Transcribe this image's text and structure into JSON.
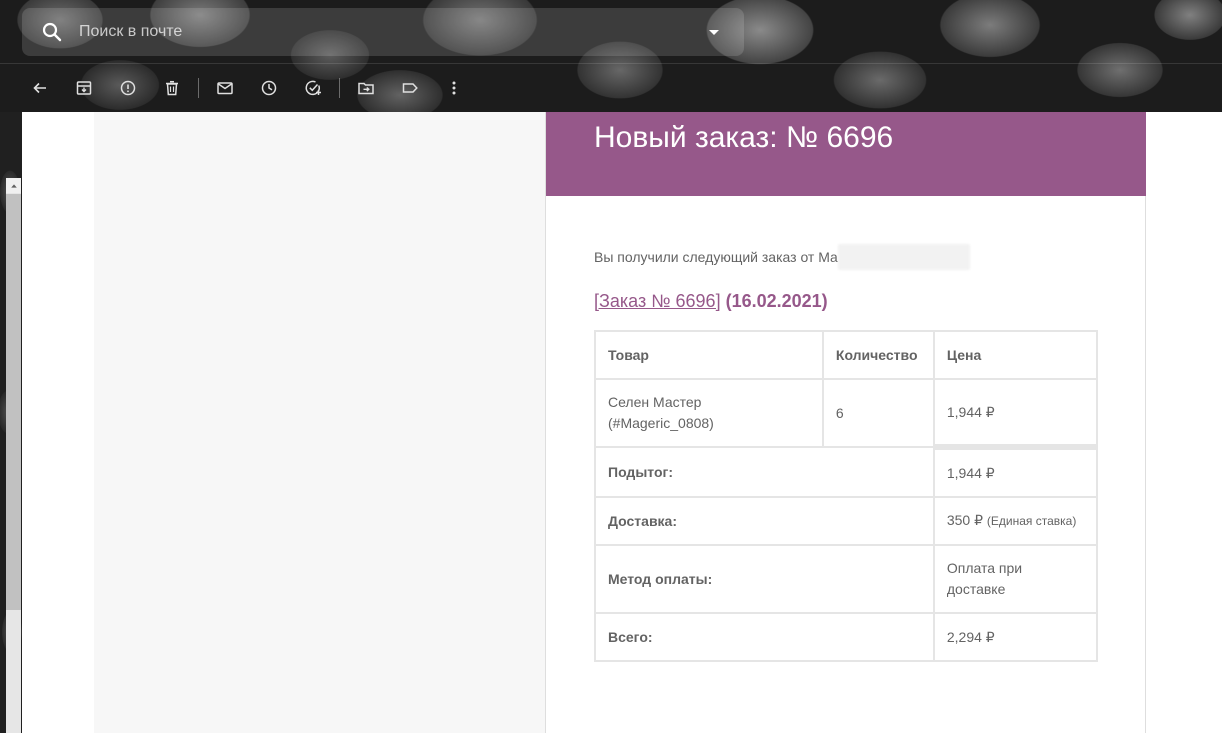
{
  "search": {
    "placeholder": "Поиск в почте"
  },
  "toolbar": {
    "icons": [
      "back-arrow-icon",
      "archive-icon",
      "report-spam-icon",
      "delete-icon",
      "mark-unread-icon",
      "snooze-icon",
      "add-task-icon",
      "move-to-icon",
      "label-icon",
      "more-vert-icon"
    ]
  },
  "email": {
    "header_title": "Новый заказ: № 6696",
    "header_color": "#96588a",
    "intro_text": "Вы получили следующий заказ от Ма",
    "order_link": "[Заказ № 6696]",
    "order_date": "(16.02.2021)",
    "table": {
      "headers": [
        "Товар",
        "Количество",
        "Цена"
      ],
      "item": {
        "name": "Селен Мастер",
        "sku": "(#Mageric_0808)",
        "qty": "6",
        "price": "1,944 ₽"
      },
      "totals": [
        {
          "label": "Подытог:",
          "value": "1,944 ₽",
          "note": ""
        },
        {
          "label": "Доставка:",
          "value": "350 ₽",
          "note": "(Единая ставка)"
        },
        {
          "label": "Метод оплаты:",
          "value": "Оплата при доставке",
          "note": ""
        },
        {
          "label": "Всего:",
          "value": "2,294 ₽",
          "note": ""
        }
      ]
    }
  }
}
